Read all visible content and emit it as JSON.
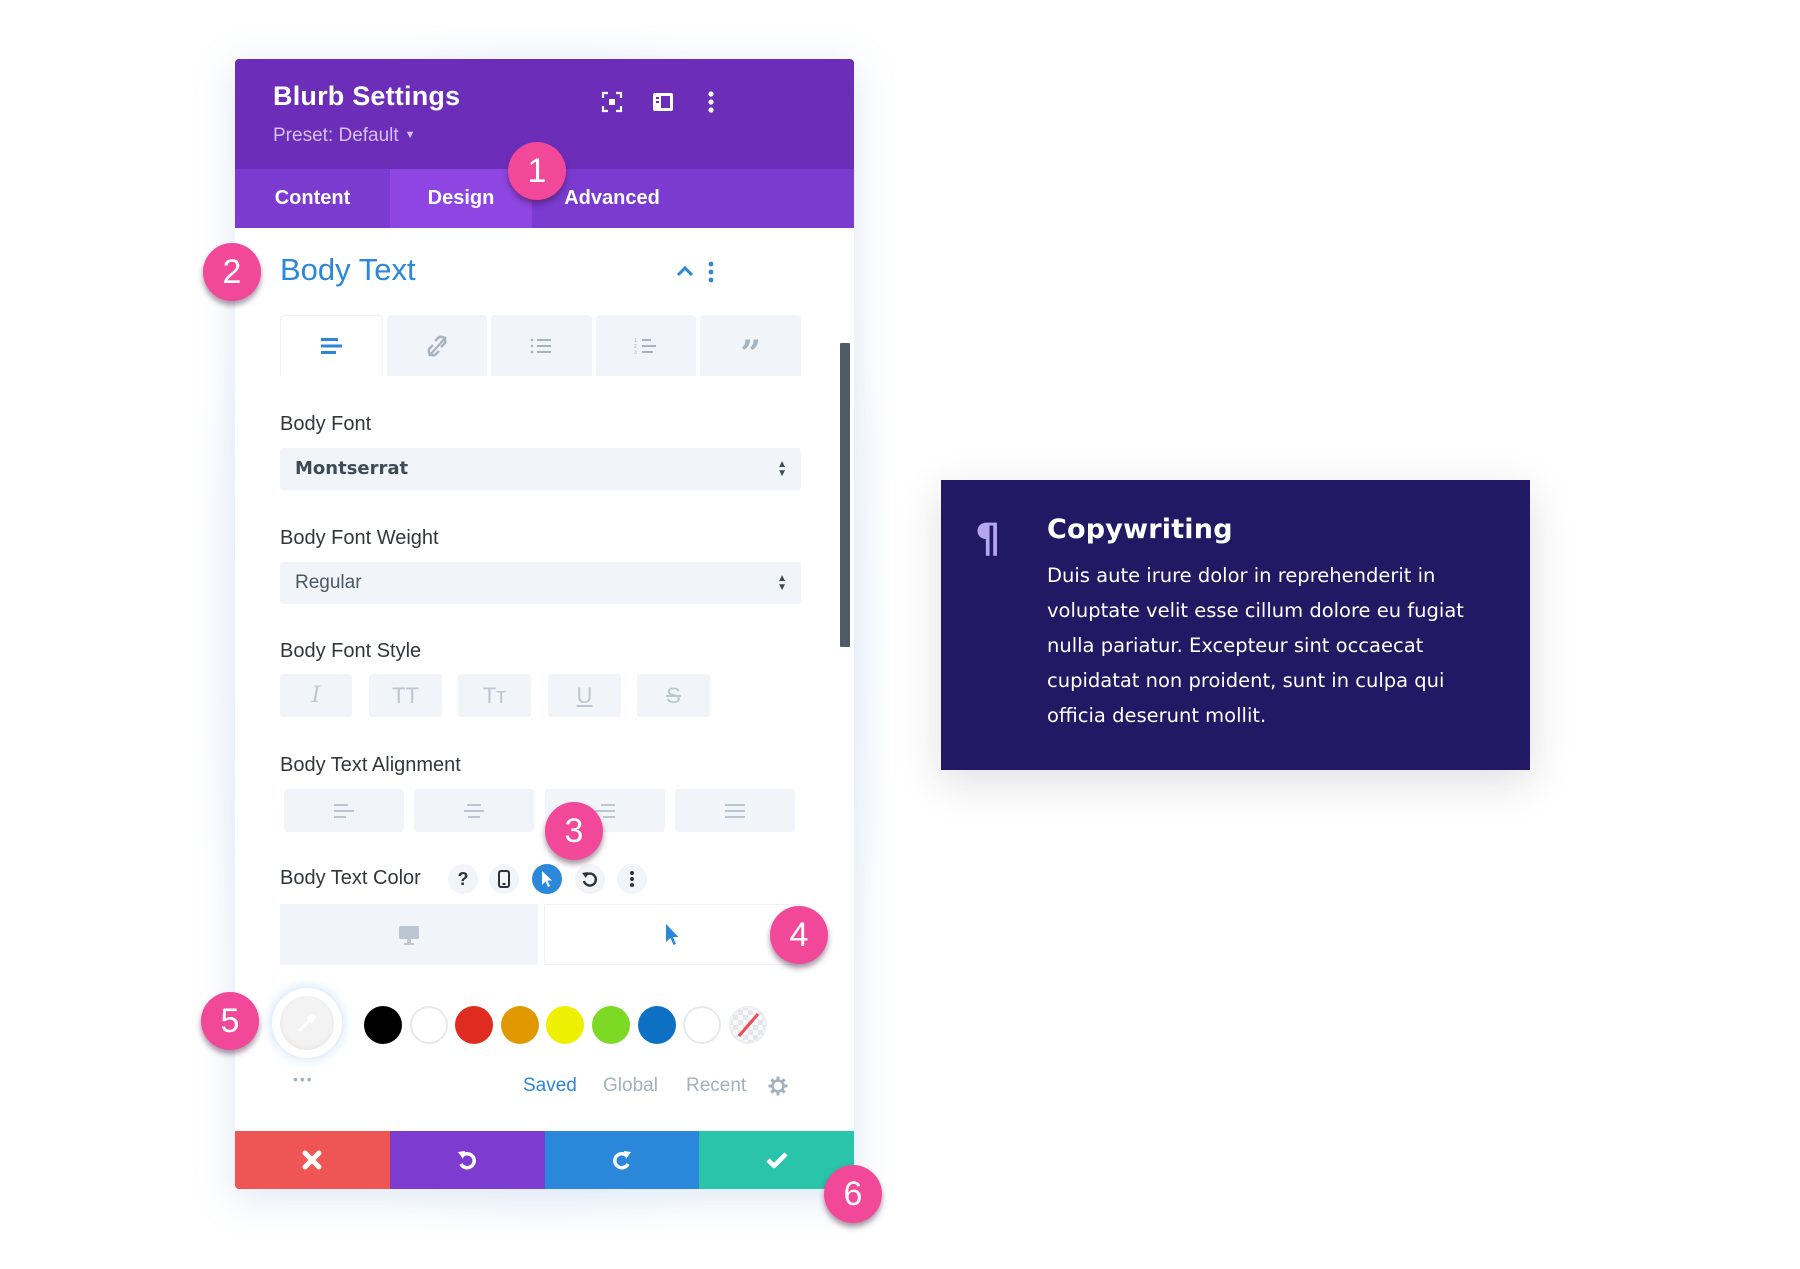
{
  "panel": {
    "title": "Blurb Settings",
    "preset_label": "Preset: Default",
    "header_icons": [
      "focus-mode-icon",
      "split-view-icon",
      "more-vertical-icon"
    ],
    "tabs": [
      {
        "label": "Content",
        "active": false
      },
      {
        "label": "Design",
        "active": true
      },
      {
        "label": "Advanced",
        "active": false
      }
    ],
    "section": {
      "title": "Body Text",
      "subtabs": [
        "text-icon",
        "link-icon",
        "unordered-list-icon",
        "ordered-list-icon",
        "quote-icon"
      ],
      "active_subtab": 0
    },
    "body_font": {
      "label": "Body Font",
      "value": "Montserrat"
    },
    "body_font_weight": {
      "label": "Body Font Weight",
      "value": "Regular"
    },
    "body_font_style": {
      "label": "Body Font Style",
      "buttons": [
        {
          "glyph": "I",
          "name": "italic"
        },
        {
          "glyph": "TT",
          "name": "uppercase"
        },
        {
          "glyph": "Tт",
          "name": "capitalize"
        },
        {
          "glyph": "U",
          "name": "underline"
        },
        {
          "glyph": "S",
          "name": "strikethrough"
        }
      ]
    },
    "body_text_alignment": {
      "label": "Body Text Alignment",
      "options": [
        "left",
        "center",
        "right",
        "justify"
      ]
    },
    "body_text_color": {
      "label": "Body Text Color",
      "controls": [
        {
          "name": "help",
          "glyph": "?",
          "active": false
        },
        {
          "name": "responsive",
          "glyph": "phone",
          "active": false
        },
        {
          "name": "hover",
          "glyph": "cursor",
          "active": true
        },
        {
          "name": "reset",
          "glyph": "↺",
          "active": false
        },
        {
          "name": "more",
          "glyph": "⋮",
          "active": false
        }
      ],
      "device_tabs": [
        {
          "name": "desktop",
          "active": false
        },
        {
          "name": "hover",
          "active": true
        }
      ],
      "swatches": [
        "#000000",
        "#ffffff",
        "#e02b20",
        "#e09900",
        "#edf000",
        "#7cda24",
        "#0c71c3",
        "#ffffff",
        "transparent"
      ],
      "palette_tabs": [
        {
          "label": "Saved",
          "active": true
        },
        {
          "label": "Global",
          "active": false
        },
        {
          "label": "Recent",
          "active": false
        }
      ],
      "more_dots": "•••"
    },
    "footer": {
      "buttons": [
        {
          "name": "discard",
          "glyph": "✖",
          "color": "#ef5555"
        },
        {
          "name": "undo",
          "glyph": "↺",
          "color": "#7e3bd0"
        },
        {
          "name": "redo",
          "glyph": "↻",
          "color": "#2b87da"
        },
        {
          "name": "save",
          "glyph": "✔",
          "color": "#29c4a9"
        }
      ]
    }
  },
  "badges": [
    "1",
    "2",
    "3",
    "4",
    "5",
    "6"
  ],
  "card": {
    "icon": "¶",
    "title": "Copywriting",
    "body": "Duis aute irure dolor in reprehenderit in voluptate velit esse cillum dolore eu fugiat nulla pariatur. Excepteur sint occaecat cupidatat non proident, sunt in culpa qui officia deserunt mollit."
  },
  "colors": {
    "header_purple": "#6c2eb9",
    "tab_purple": "#7b3ad0",
    "active_tab_purple": "#8e45e2",
    "accent_blue": "#2b87da",
    "badge_pink": "#f1489a",
    "card_bg": "#231863",
    "card_icon": "#b4a7ee"
  }
}
